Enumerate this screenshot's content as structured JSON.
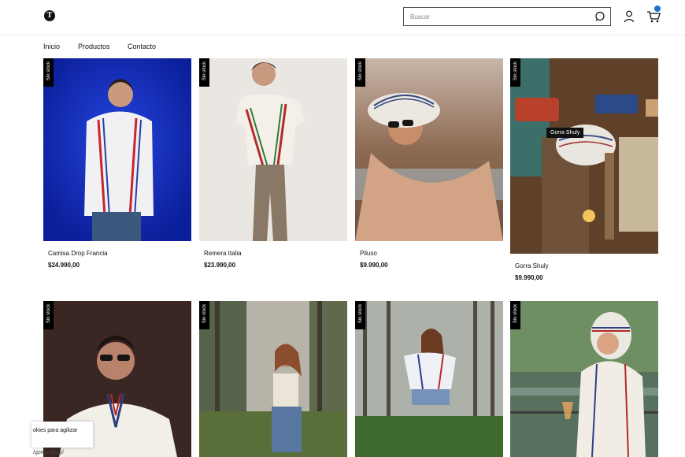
{
  "header": {
    "logo_letter": "T",
    "search_placeholder": "Buscar"
  },
  "nav": {
    "items": [
      "Inicio",
      "Productos",
      "Contacto"
    ]
  },
  "stock_label": "Sin stock",
  "products": [
    {
      "name": "Camisa Drop Francia",
      "price": "$24.990,00"
    },
    {
      "name": "Remera Italia",
      "price": "$23.990,00"
    },
    {
      "name": "Piluso",
      "price": "$9.990,00"
    },
    {
      "name": "Gorra Shuly",
      "price": "$9.990,00",
      "tooltip": "Gorra Shuly"
    },
    {
      "name": "",
      "price": ""
    },
    {
      "name": "",
      "price": ""
    },
    {
      "name": "",
      "price": ""
    },
    {
      "name": "",
      "price": ""
    }
  ],
  "cookie_text": "okies para agilizar",
  "url_fragment": "/gorra-shuly/",
  "colors": {
    "accent": "#1f6fd1",
    "stock_tag": "#000000"
  },
  "icons": {
    "search": "search-icon",
    "user": "user-icon",
    "cart": "cart-icon"
  }
}
